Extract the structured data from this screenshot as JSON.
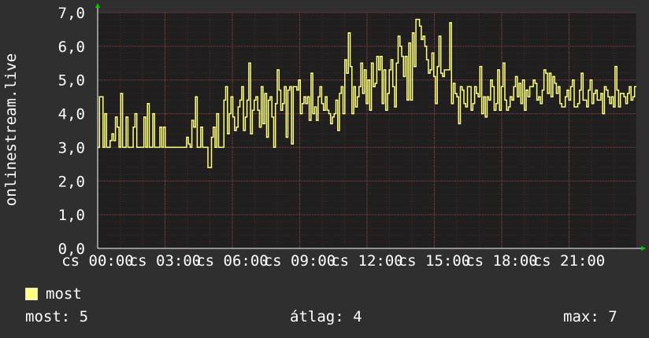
{
  "chart_data": {
    "type": "line",
    "ylabel": "onlinestream.live",
    "ylim": [
      0,
      7
    ],
    "yticks": [
      "0,0",
      "1,0",
      "2,0",
      "3,0",
      "4,0",
      "5,0",
      "6,0",
      "7,0"
    ],
    "xticks": [
      "cs 00:00",
      "cs 03:00",
      "cs 06:00",
      "cs 09:00",
      "cs 12:00",
      "cs 15:00",
      "cs 18:00",
      "cs 21:00"
    ],
    "grid": true,
    "series": [
      {
        "name": "most",
        "color": "#ffff80",
        "values": [
          3,
          4.5,
          4.5,
          3,
          4,
          3,
          3,
          3.2,
          3.4,
          3.2,
          3.9,
          3.6,
          3,
          4.6,
          3,
          3,
          3.9,
          3,
          3,
          3,
          3.6,
          4,
          3,
          3,
          3,
          3,
          3.9,
          3,
          4.3,
          3,
          3,
          4,
          3,
          3,
          3,
          3.6,
          3,
          3.6,
          3,
          3,
          3,
          3,
          3,
          3,
          3,
          3,
          3,
          3,
          3,
          3,
          3.3,
          3.1,
          3,
          3.8,
          3.6,
          4.5,
          3,
          3,
          3.6,
          3,
          3,
          3,
          2.4,
          2.4,
          3.3,
          3.6,
          3,
          4,
          3,
          3,
          3,
          4.4,
          4.8,
          3.4,
          4,
          4.5,
          3.9,
          3.5,
          3.6,
          4.2,
          4.4,
          4.8,
          3.5,
          3.9,
          4.4,
          5.5,
          3.4,
          4.1,
          4.4,
          4.5,
          4.1,
          3.6,
          4.8,
          3.7,
          4.6,
          3.3,
          4.4,
          4.5,
          3.9,
          3,
          4.3,
          5.3,
          4.7,
          4.1,
          4.3,
          4.8,
          3.3,
          4.7,
          4.8,
          3.1,
          4.8,
          4.8,
          4.7,
          5,
          4,
          4.3,
          4.5,
          4.3,
          4.5,
          3.8,
          5.2,
          4,
          4.2,
          3.8,
          4.5,
          4.8,
          4.3,
          4.1,
          4.5,
          4.1,
          4,
          3.7,
          3.9,
          4,
          4.4,
          3.5,
          4.6,
          4.8,
          4,
          5.6,
          5.2,
          6.4,
          5.4,
          4,
          4.8,
          4.2,
          4.5,
          4.8,
          5.5,
          4.6,
          5.3,
          4.3,
          5,
          4.1,
          5.5,
          4.8,
          4.9,
          5.7,
          5.3,
          5.7,
          4.3,
          5.3,
          4.1,
          4.6,
          5.3,
          5.6,
          4.8,
          4.2,
          5.5,
          6.3,
          6,
          5.7,
          5.1,
          5.7,
          4.4,
          6.1,
          4.4,
          6.4,
          5.4,
          6.8,
          6.8,
          6.6,
          6.2,
          6.3,
          6,
          5.6,
          5.2,
          5.3,
          5.8,
          5.1,
          4.3,
          5.4,
          6.3,
          5.2,
          5.1,
          5.3,
          5.3,
          5.3,
          6.7,
          4.3,
          4.9,
          4.6,
          4.5,
          3.7,
          4.8,
          4.7,
          4.3,
          4.2,
          4.8,
          4.8,
          4.1,
          4.3,
          4.8,
          4.6,
          4.5,
          5.4,
          4,
          4.5,
          3.9,
          4.5,
          4.4,
          5,
          4.8,
          4.1,
          4.3,
          5.3,
          4.1,
          4.8,
          5.5,
          4.4,
          4.1,
          4.2,
          4.5,
          4.4,
          4.8,
          5.1,
          4.5,
          4.9,
          4.3,
          5,
          4.1,
          4.7,
          4.5,
          4.8,
          4.8,
          5,
          4.9,
          4.4,
          4.5,
          4.3,
          4.7,
          5.3,
          5.2,
          4.6,
          5.2,
          4.5,
          5.1,
          4.9,
          4.6,
          4.8,
          4.3,
          4.2,
          4.2,
          4.5,
          4.7,
          4.4,
          4.8,
          5,
          4.2,
          4.2,
          4.3,
          4.7,
          5.2,
          4.4,
          4.4,
          4.2,
          4.7,
          5,
          4.3,
          4.6,
          4.7,
          4.4,
          4.4,
          4.6,
          4,
          4.8,
          4.7,
          4.5,
          4.3,
          4.5,
          4.2,
          5.4,
          4.7,
          4.2,
          4.6,
          4.6,
          4.5,
          4.3,
          4.6,
          4.8,
          4.4,
          4.5,
          4.8
        ]
      }
    ]
  },
  "legend": {
    "label": "most"
  },
  "stats": {
    "current": "most: 5",
    "average": "átlag: 4",
    "max": "max: 7"
  }
}
